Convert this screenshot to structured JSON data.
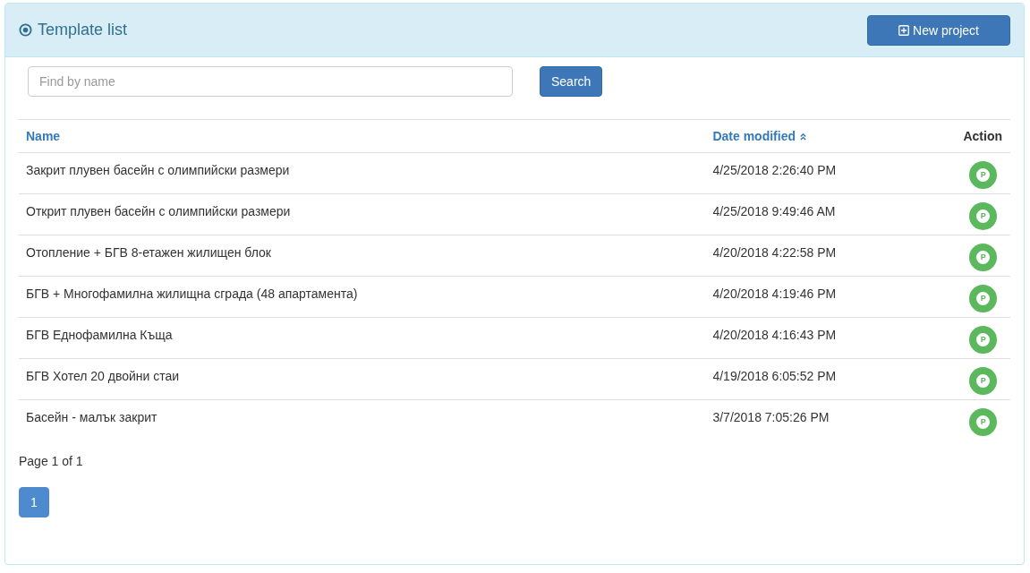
{
  "panel": {
    "title": "Template list",
    "new_button": "New project"
  },
  "search": {
    "placeholder": "Find by name",
    "button": "Search"
  },
  "table": {
    "columns": [
      {
        "label": "Name",
        "sorted": false
      },
      {
        "label": "Date modified",
        "sorted": true
      },
      {
        "label": "Action",
        "sorted": false
      }
    ],
    "rows": [
      {
        "name": "Закрит плувен басейн с олимпийски размери",
        "date": "4/25/2018 2:26:40 PM",
        "action": "P"
      },
      {
        "name": "Открит плувен басейн с олимпийски размери",
        "date": "4/25/2018 9:49:46 AM",
        "action": "P"
      },
      {
        "name": "Отопление + БГВ 8-етажен жилищен блок",
        "date": "4/20/2018 4:22:58 PM",
        "action": "P"
      },
      {
        "name": "БГВ + Многофамилна жилищна сграда (48 апартамента)",
        "date": "4/20/2018 4:19:46 PM",
        "action": "P"
      },
      {
        "name": "БГВ Еднофамилна Къща",
        "date": "4/20/2018 4:16:43 PM",
        "action": "P"
      },
      {
        "name": "БГВ Хотел 20 двойни стаи",
        "date": "4/19/2018 6:05:52 PM",
        "action": "P"
      },
      {
        "name": "Басейн - малък закрит",
        "date": "3/7/2018 7:05:26 PM",
        "action": "P"
      }
    ]
  },
  "pagination": {
    "summary": "Page 1 of 1",
    "pages": [
      {
        "label": "1",
        "selected": true
      }
    ]
  }
}
